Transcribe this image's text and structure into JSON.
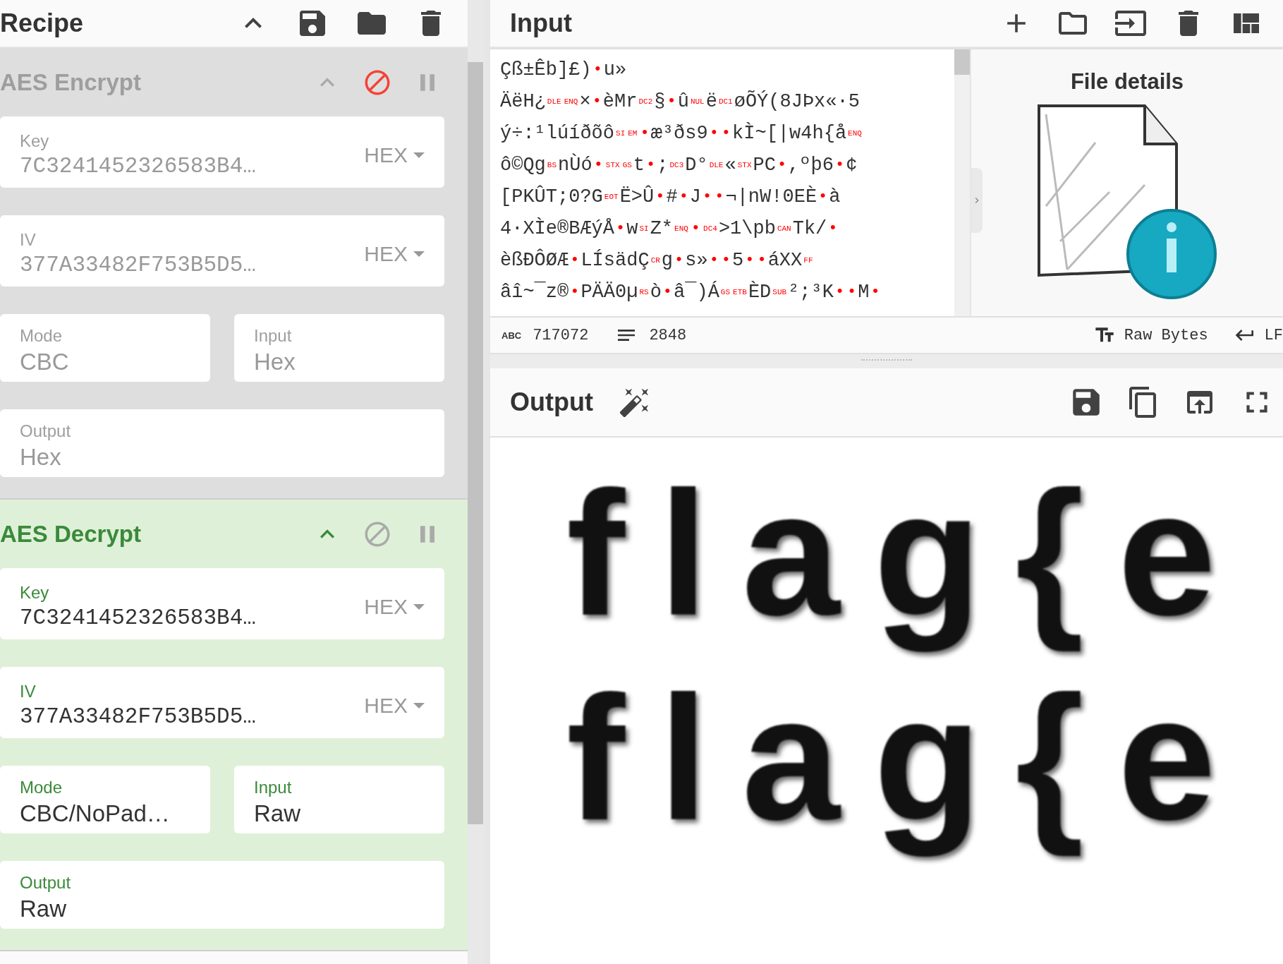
{
  "recipe": {
    "title": "Recipe",
    "operations": [
      {
        "name": "AES Encrypt",
        "disabled": true,
        "fields": [
          {
            "kind": "toggle",
            "label": "Key",
            "value": "7C3241452326583B4…",
            "option": "HEX"
          },
          {
            "kind": "toggle",
            "label": "IV",
            "value": "377A33482F753B5D5…",
            "option": "HEX"
          },
          {
            "kind": "pair",
            "items": [
              {
                "label": "Mode",
                "value": "CBC"
              },
              {
                "label": "Input",
                "value": "Hex"
              }
            ]
          },
          {
            "kind": "plain",
            "label": "Output",
            "value": "Hex"
          }
        ]
      },
      {
        "name": "AES Decrypt",
        "disabled": false,
        "fields": [
          {
            "kind": "toggle",
            "label": "Key",
            "value": "7C3241452326583B4…",
            "option": "HEX"
          },
          {
            "kind": "toggle",
            "label": "IV",
            "value": "377A33482F753B5D5…",
            "option": "HEX"
          },
          {
            "kind": "pair",
            "items": [
              {
                "label": "Mode",
                "value": "CBC/NoPad…"
              },
              {
                "label": "Input",
                "value": "Raw"
              }
            ]
          },
          {
            "kind": "plain",
            "label": "Output",
            "value": "Raw"
          }
        ]
      }
    ]
  },
  "input": {
    "title": "Input",
    "lines": [
      [
        {
          "kind": "text",
          "text": "Çß±Êb]£)"
        },
        {
          "kind": "dot",
          "text": "•"
        },
        {
          "kind": "text",
          "text": "u»"
        }
      ],
      [
        {
          "kind": "text",
          "text": "ÄëH¿"
        },
        {
          "kind": "control",
          "text": "DLE"
        },
        {
          "kind": "control",
          "text": "ENQ"
        },
        {
          "kind": "text",
          "text": "×"
        },
        {
          "kind": "dot",
          "text": "•"
        },
        {
          "kind": "text",
          "text": "èMr"
        },
        {
          "kind": "control",
          "text": "DC2"
        },
        {
          "kind": "text",
          "text": "§"
        },
        {
          "kind": "dot",
          "text": "•"
        },
        {
          "kind": "text",
          "text": "û"
        },
        {
          "kind": "control",
          "text": "NUL"
        },
        {
          "kind": "text",
          "text": "ë"
        },
        {
          "kind": "control",
          "text": "DC1"
        },
        {
          "kind": "text",
          "text": "øÕÝ(8JÞx«·5"
        }
      ],
      [
        {
          "kind": "text",
          "text": "ý÷:¹lúíðõô"
        },
        {
          "kind": "control",
          "text": "SI"
        },
        {
          "kind": "control",
          "text": "EM"
        },
        {
          "kind": "dot",
          "text": "•"
        },
        {
          "kind": "text",
          "text": "æ³ðs9"
        },
        {
          "kind": "dot",
          "text": "•"
        },
        {
          "kind": "dot",
          "text": "•"
        },
        {
          "kind": "text",
          "text": "kÌ~[|w4h{å"
        },
        {
          "kind": "control",
          "text": "ENQ"
        }
      ],
      [
        {
          "kind": "text",
          "text": "ô©Qg"
        },
        {
          "kind": "control",
          "text": "BS"
        },
        {
          "kind": "text",
          "text": "nÙó"
        },
        {
          "kind": "dot",
          "text": "•"
        },
        {
          "kind": "control",
          "text": "STX"
        },
        {
          "kind": "control",
          "text": "GS"
        },
        {
          "kind": "text",
          "text": "t"
        },
        {
          "kind": "dot",
          "text": "•"
        },
        {
          "kind": "text",
          "text": ";"
        },
        {
          "kind": "control",
          "text": "DC3"
        },
        {
          "kind": "text",
          "text": "D°"
        },
        {
          "kind": "control",
          "text": "DLE"
        },
        {
          "kind": "text",
          "text": "«"
        },
        {
          "kind": "control",
          "text": "STX"
        },
        {
          "kind": "text",
          "text": "PC"
        },
        {
          "kind": "dot",
          "text": "•"
        },
        {
          "kind": "text",
          "text": ",ºþ6"
        },
        {
          "kind": "dot",
          "text": "•"
        },
        {
          "kind": "text",
          "text": "¢"
        }
      ],
      [
        {
          "kind": "text",
          "text": "[PKÛT;0?G"
        },
        {
          "kind": "control",
          "text": "EOT"
        },
        {
          "kind": "text",
          "text": "Ë>Û"
        },
        {
          "kind": "dot",
          "text": "•"
        },
        {
          "kind": "text",
          "text": "#"
        },
        {
          "kind": "dot",
          "text": "•"
        },
        {
          "kind": "text",
          "text": "J"
        },
        {
          "kind": "dot",
          "text": "•"
        },
        {
          "kind": "dot",
          "text": "•"
        },
        {
          "kind": "text",
          "text": "¬|nW!0EÈ"
        },
        {
          "kind": "dot",
          "text": "•"
        },
        {
          "kind": "text",
          "text": "à"
        }
      ],
      [
        {
          "kind": "text",
          "text": "4·XÌe®BÆýÅ"
        },
        {
          "kind": "dot",
          "text": "•"
        },
        {
          "kind": "text",
          "text": "w"
        },
        {
          "kind": "control",
          "text": "SI"
        },
        {
          "kind": "text",
          "text": "Z*"
        },
        {
          "kind": "control",
          "text": "ENQ"
        },
        {
          "kind": "dot",
          "text": "•"
        },
        {
          "kind": "control",
          "text": "DC4"
        },
        {
          "kind": "text",
          "text": ">1\\pb"
        },
        {
          "kind": "control",
          "text": "CAN"
        },
        {
          "kind": "text",
          "text": "Tk/"
        },
        {
          "kind": "dot",
          "text": "•"
        }
      ],
      [
        {
          "kind": "text",
          "text": "èßÐÔØÆ"
        },
        {
          "kind": "dot",
          "text": "•"
        },
        {
          "kind": "text",
          "text": "LÍsädÇ"
        },
        {
          "kind": "control",
          "text": "CR"
        },
        {
          "kind": "text",
          "text": "g"
        },
        {
          "kind": "dot",
          "text": "•"
        },
        {
          "kind": "text",
          "text": "s»"
        },
        {
          "kind": "dot",
          "text": "•"
        },
        {
          "kind": "dot",
          "text": "•"
        },
        {
          "kind": "text",
          "text": "5"
        },
        {
          "kind": "dot",
          "text": "•"
        },
        {
          "kind": "dot",
          "text": "•"
        },
        {
          "kind": "text",
          "text": "áXX"
        },
        {
          "kind": "control",
          "text": "FF"
        }
      ],
      [
        {
          "kind": "text",
          "text": "âî~¯z®"
        },
        {
          "kind": "dot",
          "text": "•"
        },
        {
          "kind": "text",
          "text": "PÄÄ0µ"
        },
        {
          "kind": "control",
          "text": "RS"
        },
        {
          "kind": "text",
          "text": "ò"
        },
        {
          "kind": "dot",
          "text": "•"
        },
        {
          "kind": "text",
          "text": "â¯)Á"
        },
        {
          "kind": "control",
          "text": "GS"
        },
        {
          "kind": "control",
          "text": "ETB"
        },
        {
          "kind": "text",
          "text": "ÈD"
        },
        {
          "kind": "control",
          "text": "SUB"
        },
        {
          "kind": "text",
          "text": "²;³K"
        },
        {
          "kind": "dot",
          "text": "•"
        },
        {
          "kind": "dot",
          "text": "•"
        },
        {
          "kind": "text",
          "text": "M"
        },
        {
          "kind": "dot",
          "text": "•"
        }
      ]
    ],
    "file_details": {
      "title": "File details"
    },
    "status": {
      "abc_label": "ABC",
      "length": "717072",
      "lines": "2848",
      "encoding": "Raw Bytes",
      "eol": "LF"
    }
  },
  "output": {
    "title": "Output",
    "lines": [
      "flag{e",
      "flag{e"
    ]
  }
}
